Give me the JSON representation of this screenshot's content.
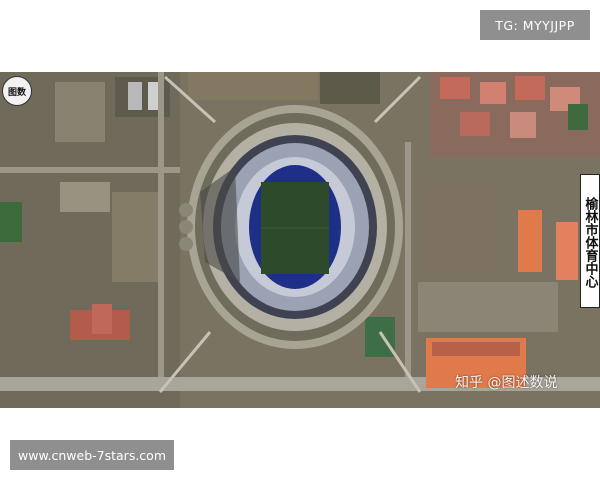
{
  "header_badge": {
    "text": "TG: MYYJJPP"
  },
  "aerial_photo": {
    "subject": "stadium",
    "logo_badge": "图数",
    "place_label": "榆林市体育中心",
    "watermark": "知乎 @图述数说",
    "colors": {
      "pitch": "#2d4a2a",
      "track": "#1d2f86",
      "stands": "#9aa2b4",
      "roof_orange": "#e07a4a",
      "ground": "#7b7361"
    }
  },
  "footer_badge": {
    "text": "www.cnweb-7stars.com"
  }
}
